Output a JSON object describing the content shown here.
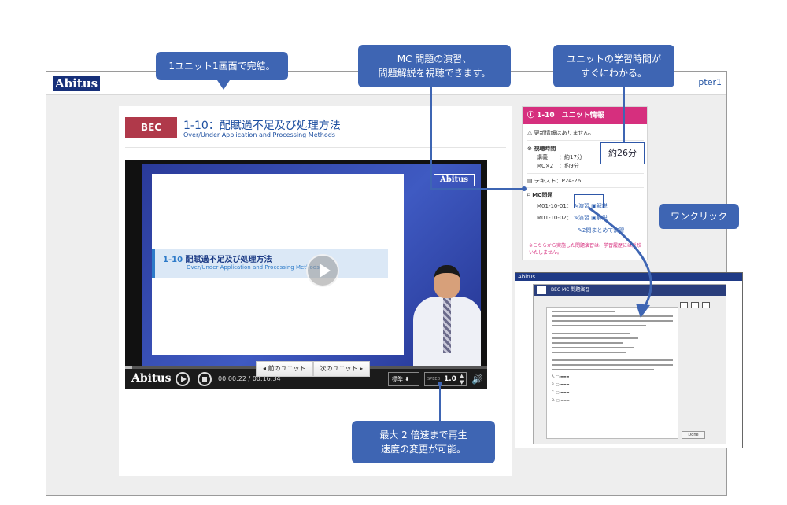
{
  "app": {
    "logo": "Abitus",
    "chapter_label": "pter1"
  },
  "lesson": {
    "badge": "BEC",
    "title": "1-10：配賦過不足及び処理方法",
    "subtitle": "Over/Under Application and Processing Methods"
  },
  "video": {
    "logo": "Abitus",
    "slide_number": "1-10",
    "slide_title": "配賦過不足及び処理方法",
    "slide_subtitle": "Over/Under Application and Processing Methods",
    "player_logo": "Abitus",
    "time": "00:00:22 / 00:16:34",
    "progress": 0.02,
    "quality": "標準",
    "speed_label": "SPEED",
    "speed": "1.0"
  },
  "pager": {
    "prev": "前のユニット",
    "next": "次のユニット"
  },
  "info_panel": {
    "header": "1-10　ユニット情報",
    "update_notice": "更新情報はありません。",
    "viewing_time_label": "視聴時間",
    "lecture_label": "講義",
    "lecture_time": "：約17分",
    "mc_label": "MC×2",
    "mc_time": "：約9分",
    "total_time": "約26分",
    "text_label": "テキスト：P24-26",
    "mc_section_label": "MC問題",
    "items": [
      {
        "id": "M01-10-01：",
        "exercise": "演習",
        "explanation": "解説"
      },
      {
        "id": "M01-10-02：",
        "exercise": "演習",
        "explanation": "解説"
      }
    ],
    "combined_exercise": "2問まとめて演習",
    "note": "※こちらから実施した問題演習は、学習履歴には反映いたしません。"
  },
  "mc_window": {
    "topbar": "Abitus",
    "title": "BEC  MC 問題演習",
    "done_button": "Done"
  },
  "callouts": {
    "one_screen": "1ユニット1画面で完結。",
    "mc_practice": "MC 問題の演習、\n問題解説を視聴できます。",
    "study_time": "ユニットの学習時間が\nすぐにわかる。",
    "one_click": "ワンクリック",
    "speed": "最大 2 倍速まで再生\n速度の変更が可能。"
  },
  "colors": {
    "callout": "#3e65b3",
    "badge": "#b0394a",
    "panel_header": "#d62f7e"
  }
}
